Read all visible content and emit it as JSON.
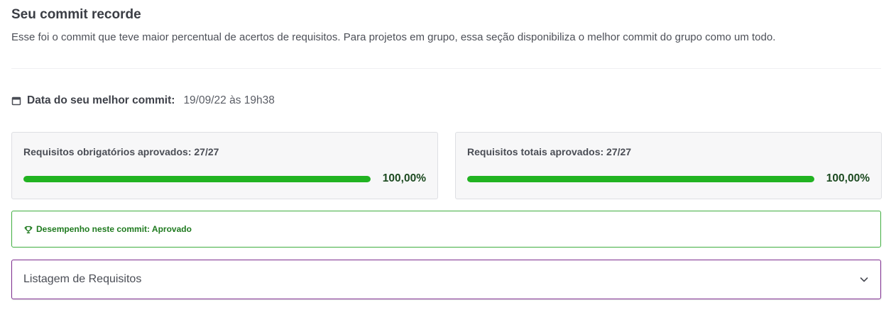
{
  "section": {
    "title": "Seu commit recorde",
    "subtitle": "Esse foi o commit que teve maior percentual de acertos de requisitos. Para projetos em grupo, essa seção disponibiliza o melhor commit do grupo como um todo."
  },
  "best_commit": {
    "icon": "calendar-icon",
    "label": "Data do seu melhor commit:",
    "value": "19/09/22 às 19h38"
  },
  "cards": [
    {
      "label": "Requisitos obrigatórios aprovados: 27/27",
      "percent_text": "100,00%",
      "progress": 1.0
    },
    {
      "label": "Requisitos totais aprovados: 27/27",
      "percent_text": "100,00%",
      "progress": 1.0
    }
  ],
  "performance": {
    "icon": "trophy-icon",
    "text": "Desempenho neste commit: Aprovado"
  },
  "requirements_accordion": {
    "label": "Listagem de Requisitos",
    "icon": "chevron-down-icon"
  },
  "colors": {
    "success_green": "#21b321",
    "border_green": "#3fae3f",
    "accent_purple": "#7e2d8f"
  }
}
